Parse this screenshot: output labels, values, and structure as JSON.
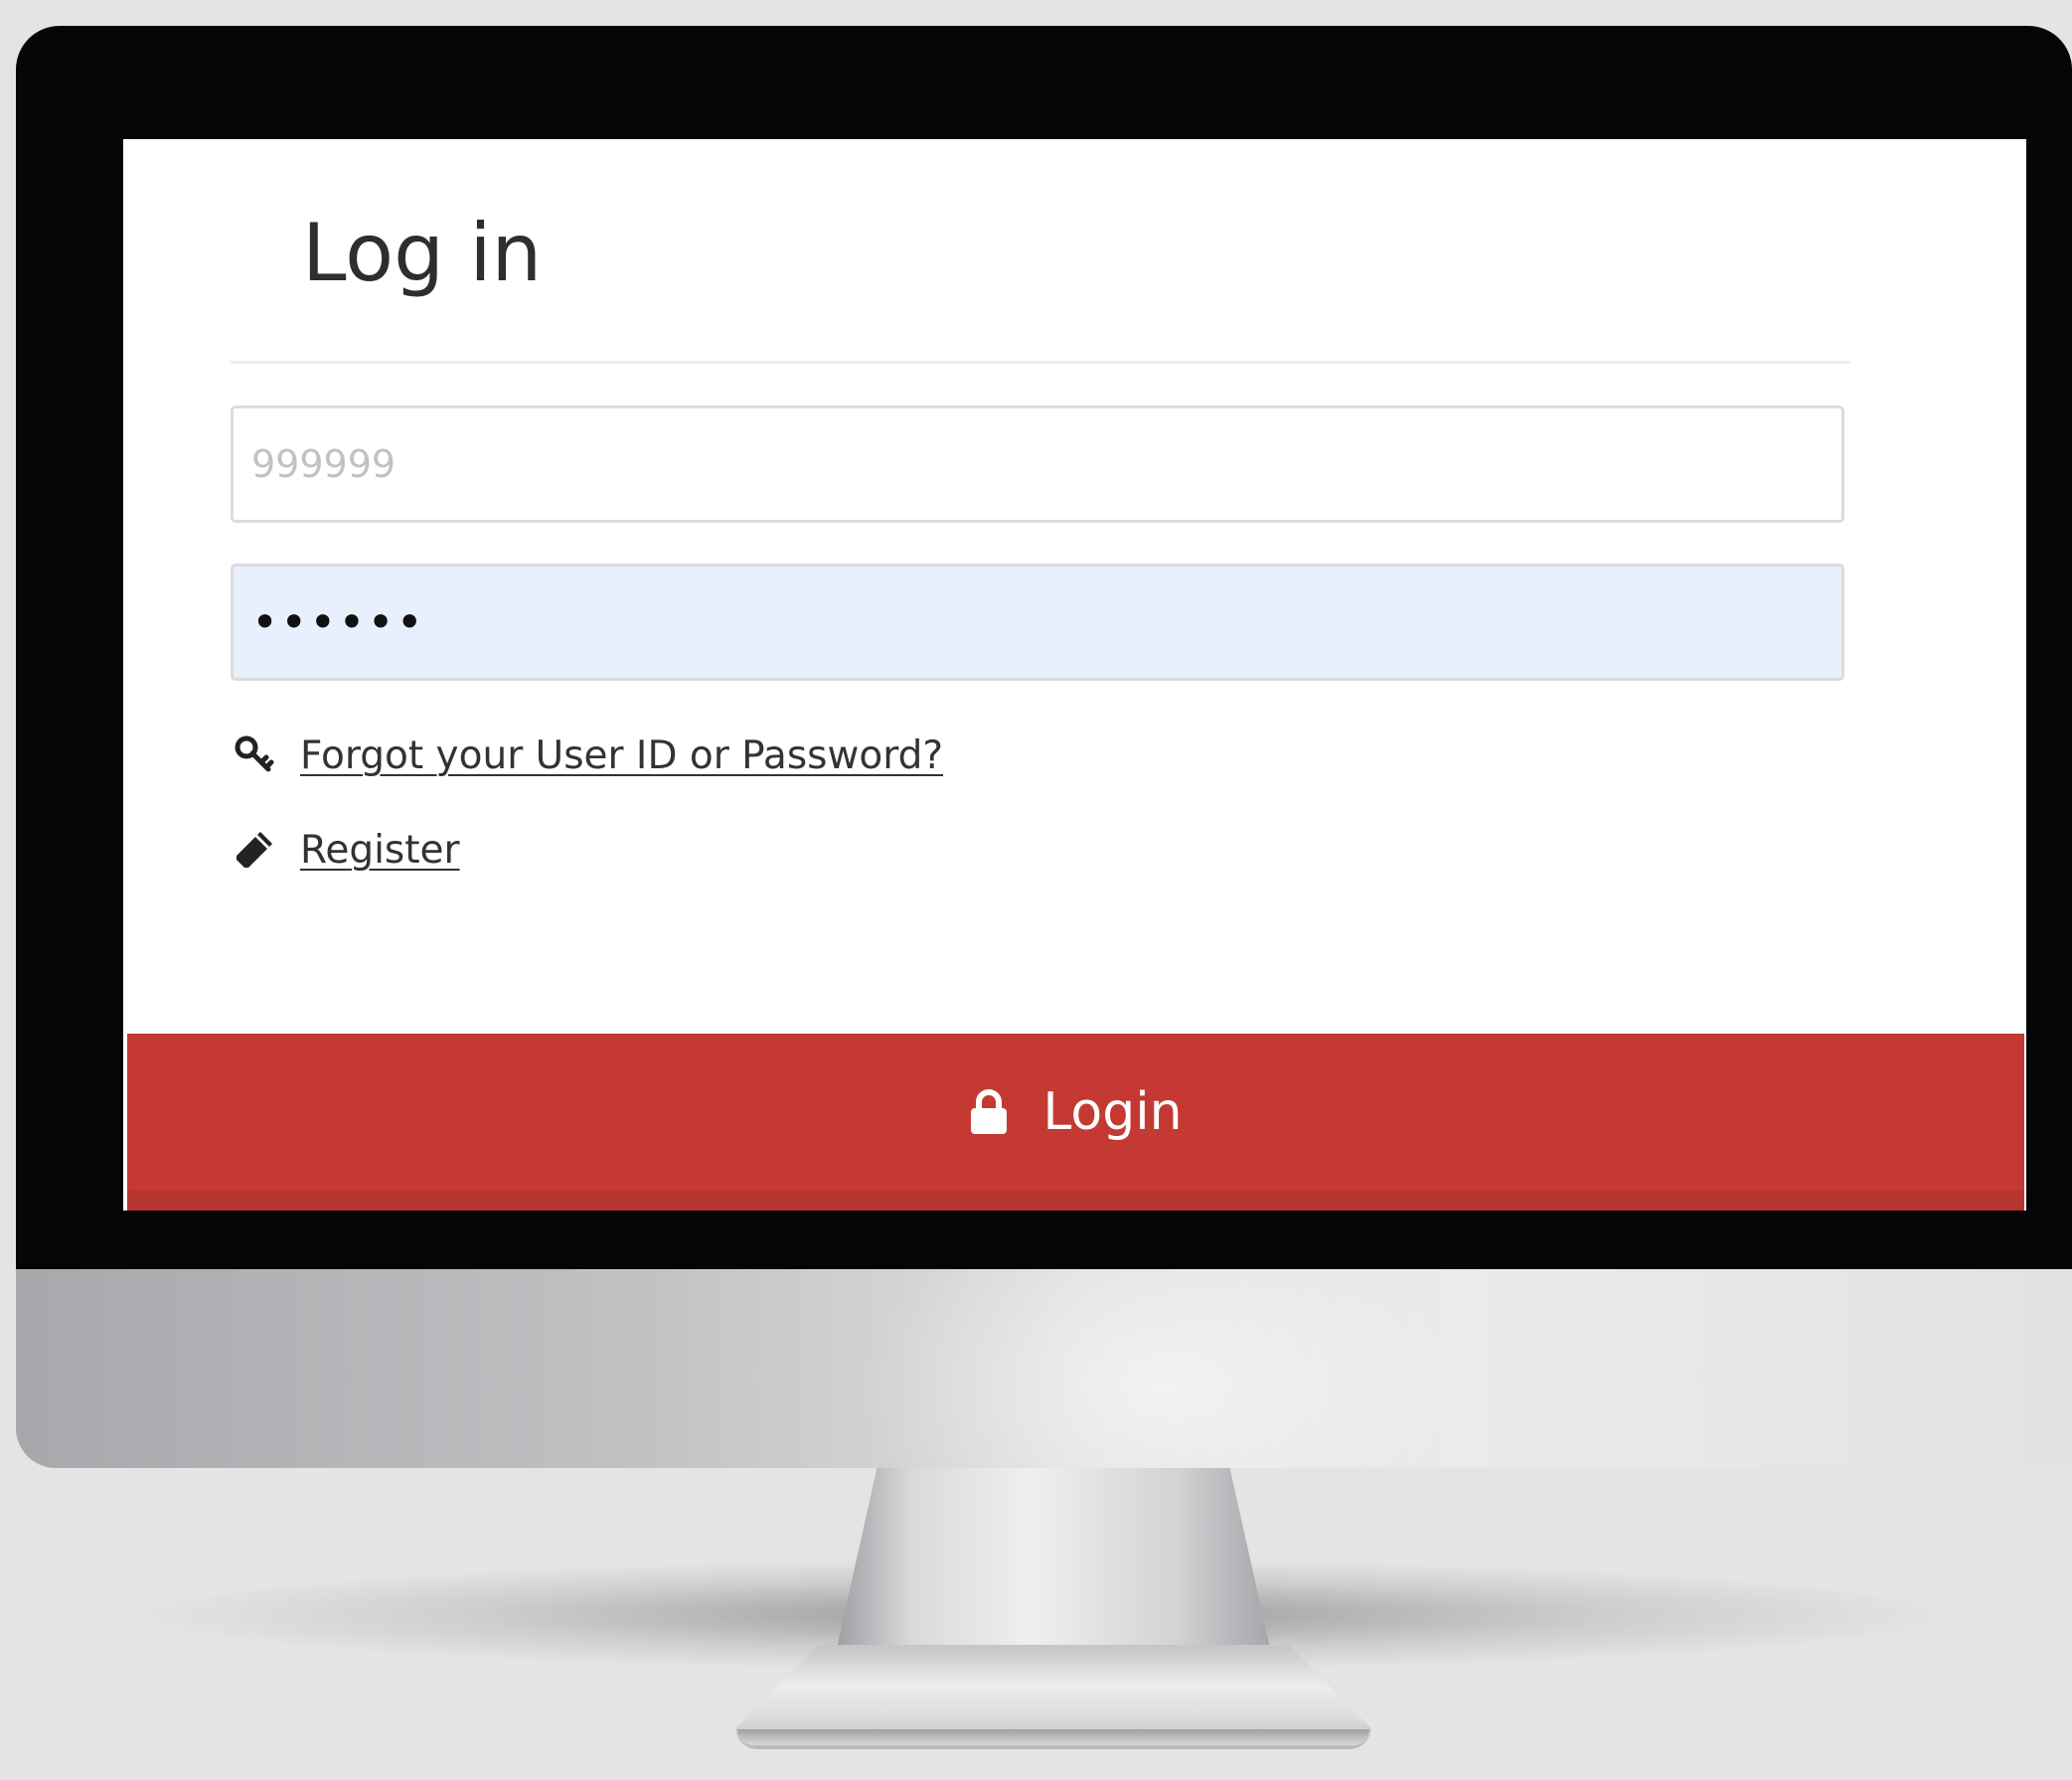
{
  "page": {
    "title": "Log in"
  },
  "form": {
    "userid_placeholder": "999999",
    "password_value": "••••••"
  },
  "links": {
    "forgot_label": "Forgot your User ID or Password?",
    "register_label": "Register"
  },
  "button": {
    "login_label": "Login"
  },
  "icons": {
    "forgot": "key-icon",
    "register": "pencil-icon",
    "login": "lock-icon"
  },
  "colors": {
    "login_button": "#c43a32",
    "password_autofill_bg": "#e8f0fe",
    "bezel": "#050505"
  }
}
